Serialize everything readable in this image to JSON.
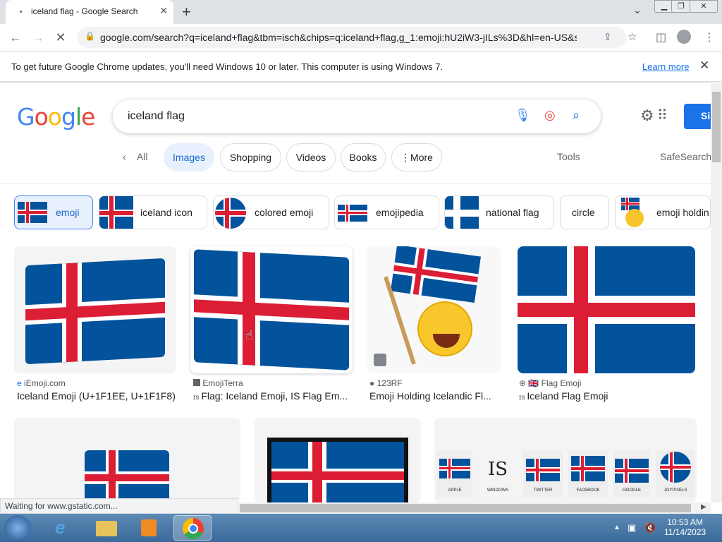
{
  "browser": {
    "tab_title": "iceland flag - Google Search",
    "url": "google.com/search?q=iceland+flag&tbm=isch&chips=q:iceland+flag,g_1:emoji:hU2iW3-jILs%3D&hl=en-US&sa...",
    "infobar_message": "To get future Google Chrome updates, you'll need Windows 10 or later. This computer is using Windows 7.",
    "infobar_link": "Learn more",
    "status_text": "Waiting for www.gstatic.com..."
  },
  "google": {
    "logo": "Google",
    "query": "iceland flag",
    "signin_label": "Si",
    "nav": {
      "all": "All",
      "images": "Images",
      "shopping": "Shopping",
      "videos": "Videos",
      "books": "Books",
      "more": "More",
      "tools": "Tools",
      "safesearch": "SafeSearch"
    },
    "chips": [
      "emoji",
      "iceland icon",
      "colored emoji",
      "emojipedia",
      "national flag",
      "circle",
      "emoji holdin"
    ]
  },
  "results": [
    {
      "source": "iEmoji.com",
      "title": "Iceland Emoji (U+1F1EE, U+1F1F8)"
    },
    {
      "source": "EmojiTerra",
      "title": "Flag: Iceland Emoji, IS Flag Em..."
    },
    {
      "source": "123RF",
      "title": "Emoji Holding Icelandic Fl..."
    },
    {
      "source": "🇬🇧 Flag Emoji",
      "title": "Iceland Flag Emoji"
    }
  ],
  "platform_strip": [
    "APPLE",
    "WINDOWS",
    "TWITTER",
    "FACEBOOK",
    "GOOGLE",
    "JOYPIXELS"
  ],
  "platform_is_text": "IS",
  "taskbar": {
    "time": "10:53 AM",
    "date": "11/14/2023"
  },
  "colors": {
    "flag_blue": "#02529c",
    "flag_red": "#dc1e35",
    "accent": "#1a73e8"
  }
}
